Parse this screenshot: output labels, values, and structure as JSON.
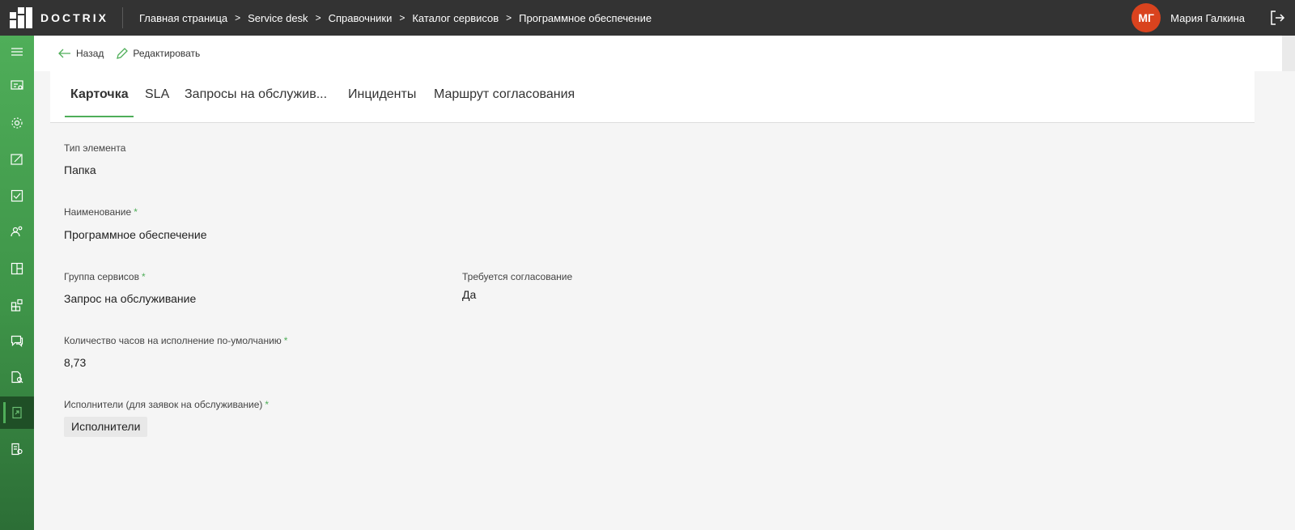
{
  "app": {
    "brand": "DOCTRIX"
  },
  "breadcrumb": [
    "Главная страница",
    "Service desk",
    "Справочники",
    "Каталог сервисов",
    "Программное обеспечение"
  ],
  "user": {
    "initials": "МГ",
    "name": "Мария Галкина",
    "avatar_color": "#d9431e"
  },
  "actions": {
    "back": "Назад",
    "edit": "Редактировать"
  },
  "tabs": [
    "Карточка",
    "SLA",
    "Запросы на обслужив...",
    "Инциденты",
    "Маршрут согласования"
  ],
  "active_tab": "Карточка",
  "fields": {
    "type": {
      "label": "Тип элемента",
      "value": "Папка"
    },
    "name": {
      "label": "Наименование",
      "required": "*",
      "value": "Программное обеспечение"
    },
    "group": {
      "label": "Группа сервисов",
      "required": "*",
      "value": "Запрос на обслуживание"
    },
    "approval": {
      "label": "Требуется согласование",
      "value": "Да"
    },
    "hours": {
      "label": "Количество часов на исполнение по-умолчанию",
      "required": "*",
      "value": "8,73"
    },
    "executors": {
      "label": "Исполнители (для заявок на обслуживание)",
      "required": "*",
      "value": "Исполнители"
    }
  },
  "sidebar": {
    "icons": [
      "menu-icon",
      "dashboard-icon",
      "settings-icon",
      "edit-icon",
      "checkbox-icon",
      "users-icon",
      "layout-icon",
      "widgets-icon",
      "chat-icon",
      "document-search-icon",
      "service-catalog-icon",
      "reports-icon"
    ],
    "active_index": 10
  },
  "colors": {
    "accent": "#4fae59",
    "topbar": "#333333",
    "sidebar_dark": "#1f4f26"
  }
}
